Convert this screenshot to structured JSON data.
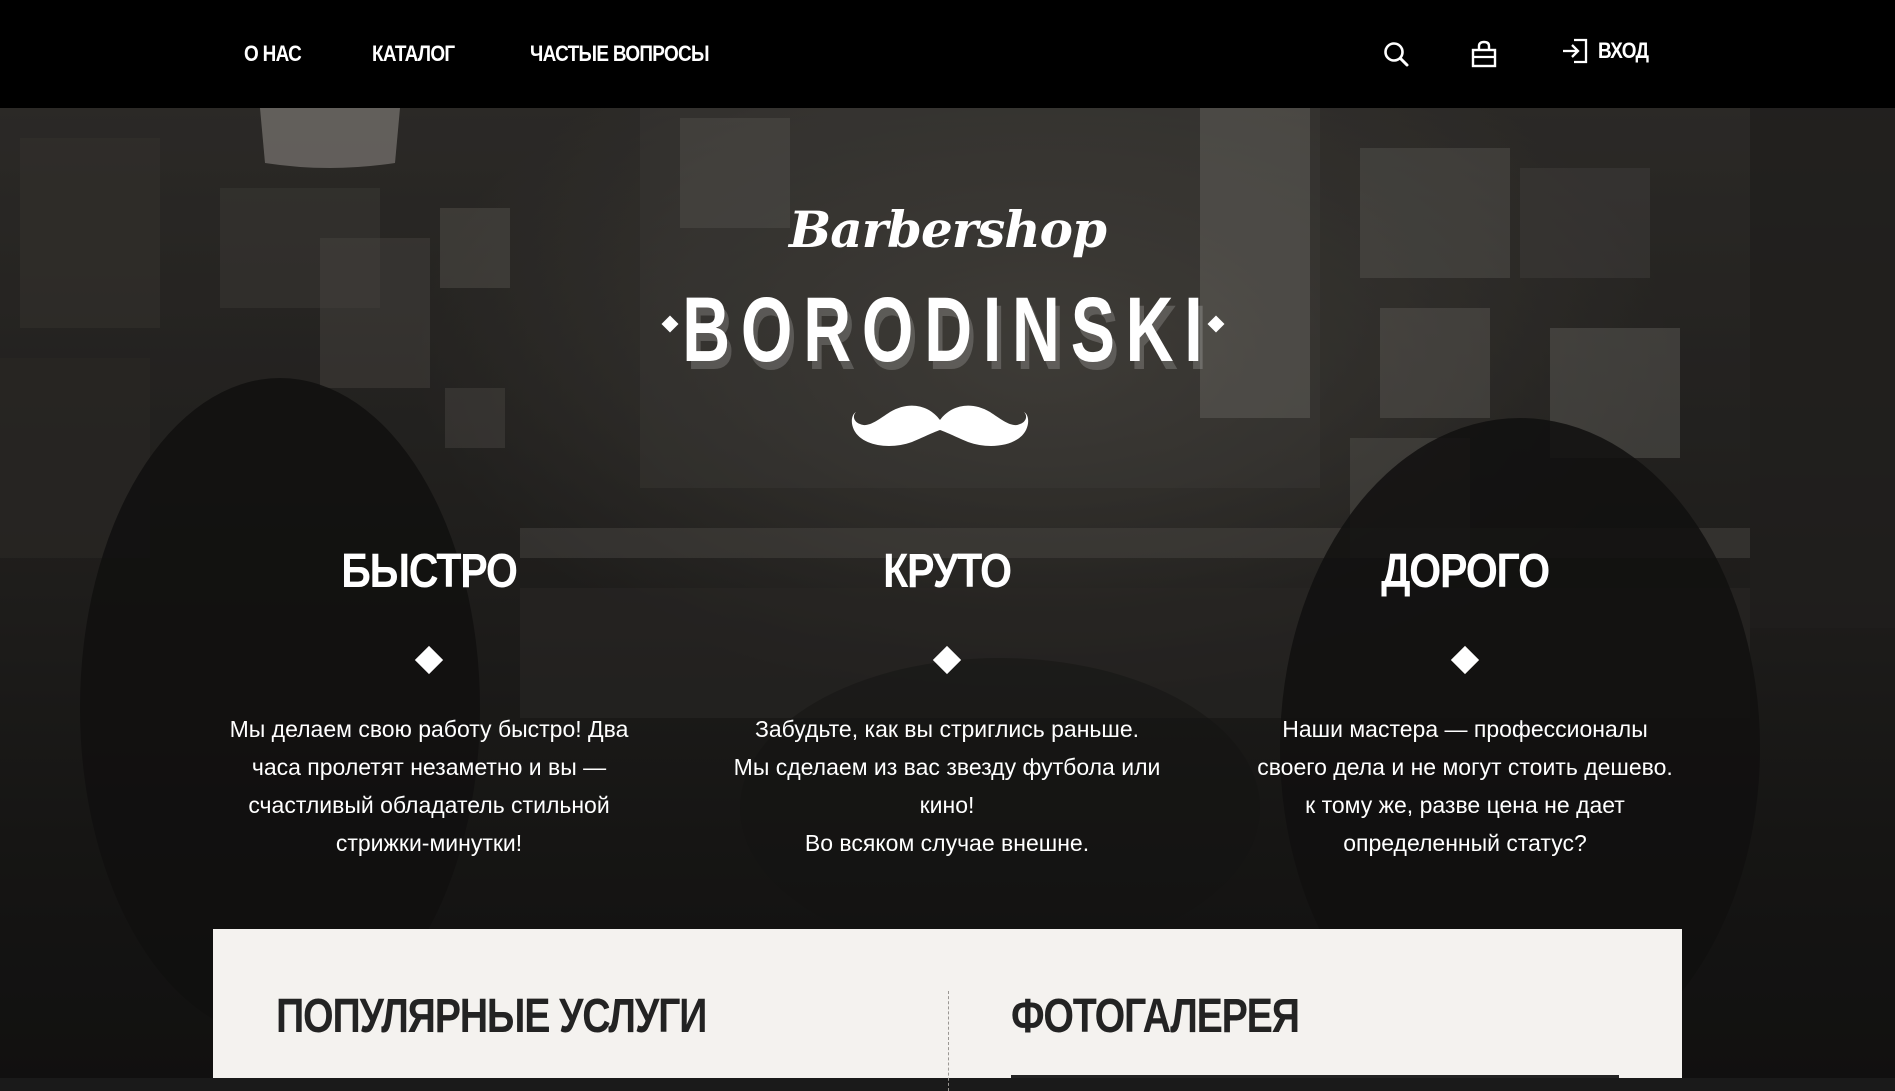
{
  "nav": {
    "items": [
      {
        "label": "О НАС"
      },
      {
        "label": "КАТАЛОГ"
      },
      {
        "label": "ЧАСТЫЕ ВОПРОСЫ"
      }
    ],
    "search_icon": "search-icon",
    "cart_icon": "basket-icon",
    "login_icon": "login-icon",
    "login_label": "ВХОД"
  },
  "brand": {
    "script": "Barbershop",
    "name": "BORODINSKI",
    "mustache_icon": "mustache-icon"
  },
  "features": [
    {
      "title": "БЫСТРО",
      "text": "Мы делаем свою работу быстро! Два\nчаса пролетят незаметно и вы —\nсчастливый обладатель стильной\nстрижки-минутки!"
    },
    {
      "title": "КРУТО",
      "text": "Забудьте, как вы стриглись раньше.\nМы сделаем из вас звезду футбола или\nкино!\nВо всяком случае внешне."
    },
    {
      "title": "ДОРОГО",
      "text": "Наши мастера — профессионалы\nсвоего дела и не могут стоить дешево.\nк тому же, разве цена не дает\nопределенный статус?"
    }
  ],
  "panel": {
    "services_title": "ПОПУЛЯРНЫЕ УСЛУГИ",
    "gallery_title": "ФОТОГАЛЕРЕЯ"
  },
  "colors": {
    "topbar": "#000000",
    "text": "#ffffff",
    "panel": "#f4f2ef",
    "panel_text": "#232323"
  }
}
